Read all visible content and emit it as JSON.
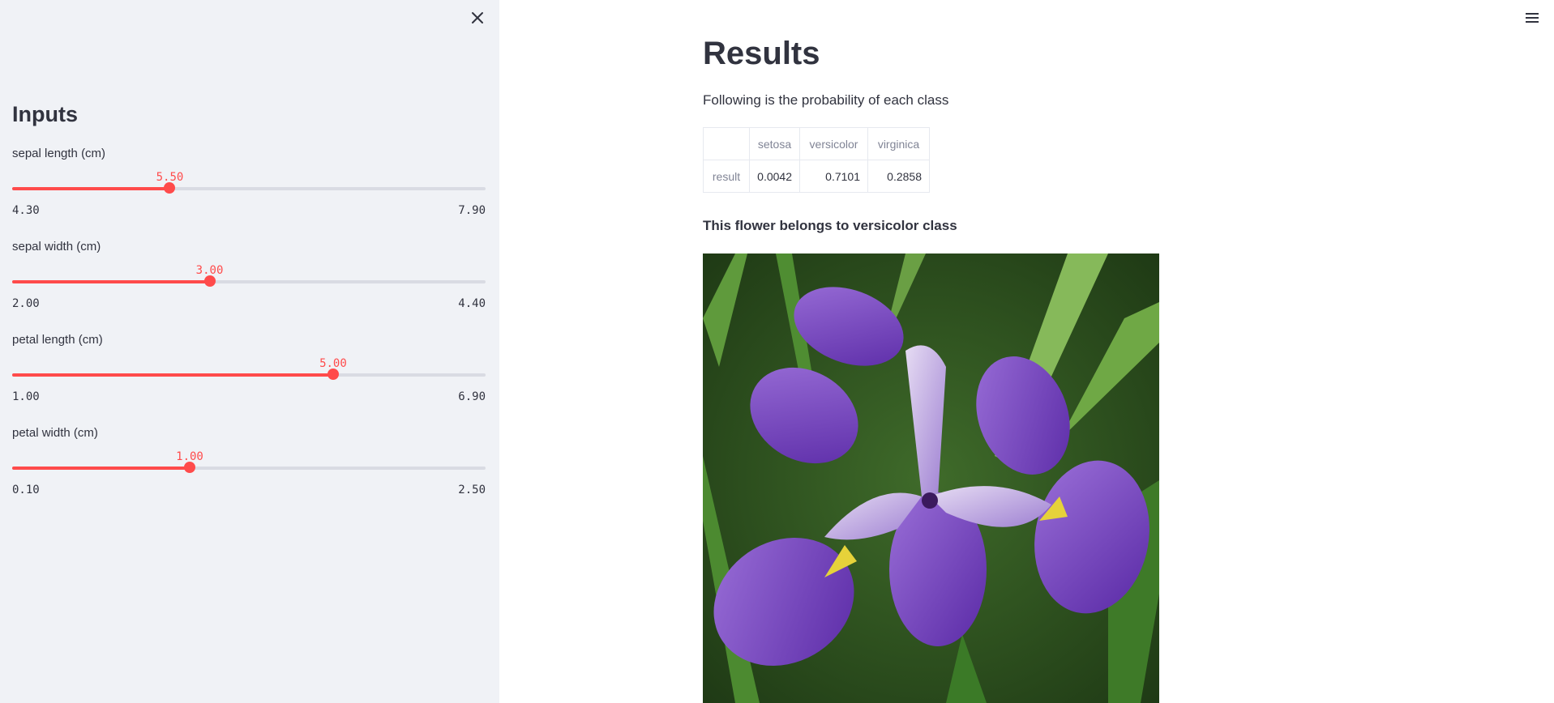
{
  "sidebar": {
    "title": "Inputs",
    "sliders": [
      {
        "label": "sepal length (cm)",
        "value": "5.50",
        "min": "4.30",
        "max": "7.90",
        "fraction": 0.333
      },
      {
        "label": "sepal width (cm)",
        "value": "3.00",
        "min": "2.00",
        "max": "4.40",
        "fraction": 0.417
      },
      {
        "label": "petal length (cm)",
        "value": "5.00",
        "min": "1.00",
        "max": "6.90",
        "fraction": 0.678
      },
      {
        "label": "petal width (cm)",
        "value": "1.00",
        "min": "0.10",
        "max": "2.50",
        "fraction": 0.375
      }
    ],
    "accent_color": "#ff4b4b",
    "close_icon": "close-icon"
  },
  "main": {
    "title": "Results",
    "caption": "Following is the probability of each class",
    "table": {
      "columns": [
        "",
        "setosa",
        "versicolor",
        "virginica"
      ],
      "rows": [
        {
          "label": "result",
          "values": [
            "0.0042",
            "0.7101",
            "0.2858"
          ]
        }
      ]
    },
    "prediction_text": "This flower belongs to versicolor class",
    "image_subject": "purple iris flower photo",
    "menu_icon": "hamburger-menu-icon"
  }
}
